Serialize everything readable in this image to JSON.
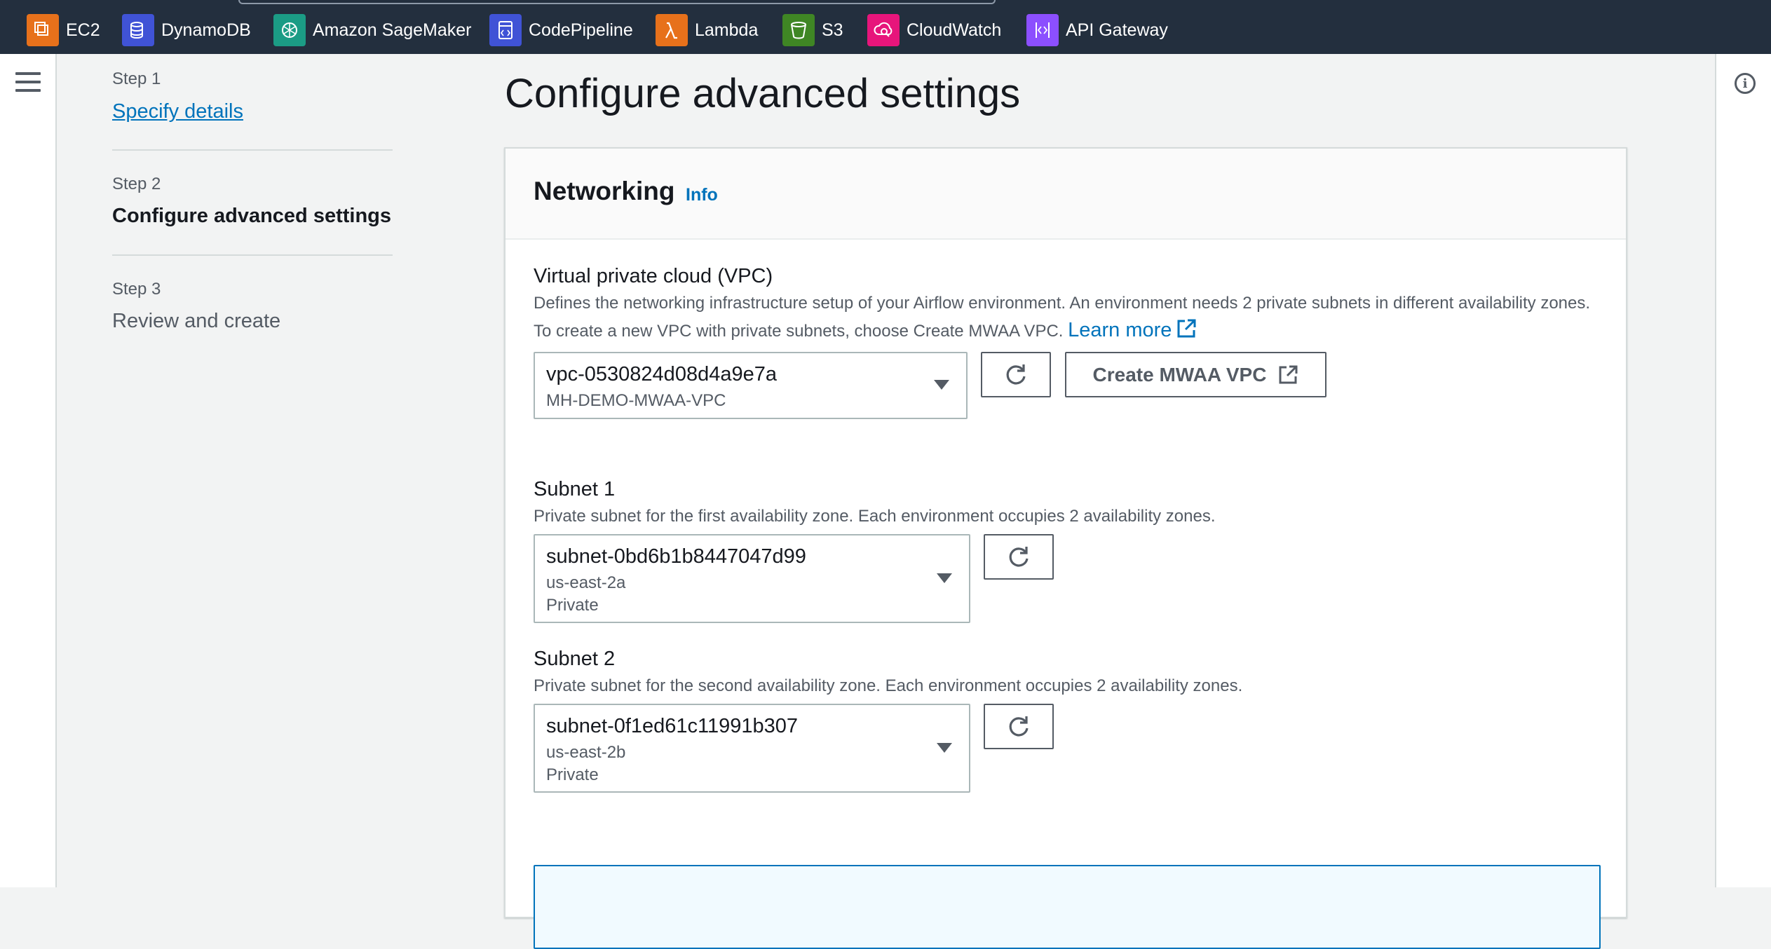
{
  "topbar": {
    "services": [
      {
        "label": "EC2",
        "icon": "ec2-icon",
        "color": "#e7711b"
      },
      {
        "label": "DynamoDB",
        "icon": "dynamodb-icon",
        "color": "#4053d6"
      },
      {
        "label": "Amazon SageMaker",
        "icon": "sagemaker-icon",
        "color": "#1b9c85"
      },
      {
        "label": "CodePipeline",
        "icon": "codepipeline-icon",
        "color": "#4053d6"
      },
      {
        "label": "Lambda",
        "icon": "lambda-icon",
        "color": "#e7711b"
      },
      {
        "label": "S3",
        "icon": "s3-icon",
        "color": "#3f8624"
      },
      {
        "label": "CloudWatch",
        "icon": "cloudwatch-icon",
        "color": "#e7157b"
      },
      {
        "label": "API Gateway",
        "icon": "api-gateway-icon",
        "color": "#8c4fff"
      }
    ]
  },
  "steps": [
    {
      "label": "Step 1",
      "title": "Specify details",
      "state": "completed"
    },
    {
      "label": "Step 2",
      "title": "Configure advanced settings",
      "state": "current"
    },
    {
      "label": "Step 3",
      "title": "Review and create",
      "state": "upcoming"
    }
  ],
  "page": {
    "title": "Configure advanced settings"
  },
  "networking": {
    "heading": "Networking",
    "info": "Info",
    "vpc": {
      "label": "Virtual private cloud (VPC)",
      "description": "Defines the networking infrastructure setup of your Airflow environment. An environment needs 2 private subnets in different availability zones. To create a new VPC with private subnets, choose Create MWAA VPC.",
      "learn_more": "Learn more",
      "selected_id": "vpc-0530824d08d4a9e7a",
      "selected_name": "MH-DEMO-MWAA-VPC",
      "create_button": "Create MWAA VPC"
    },
    "subnet1": {
      "label": "Subnet 1",
      "description": "Private subnet for the first availability zone. Each environment occupies 2 availability zones.",
      "selected_id": "subnet-0bd6b1b8447047d99",
      "zone": "us-east-2a",
      "type": "Private"
    },
    "subnet2": {
      "label": "Subnet 2",
      "description": "Private subnet for the second availability zone. Each environment occupies 2 availability zones.",
      "selected_id": "subnet-0f1ed61c11991b307",
      "zone": "us-east-2b",
      "type": "Private"
    }
  },
  "colors": {
    "link": "#0073bb",
    "nav_bg": "#232f3e",
    "text": "#16191f",
    "muted": "#545b64"
  }
}
